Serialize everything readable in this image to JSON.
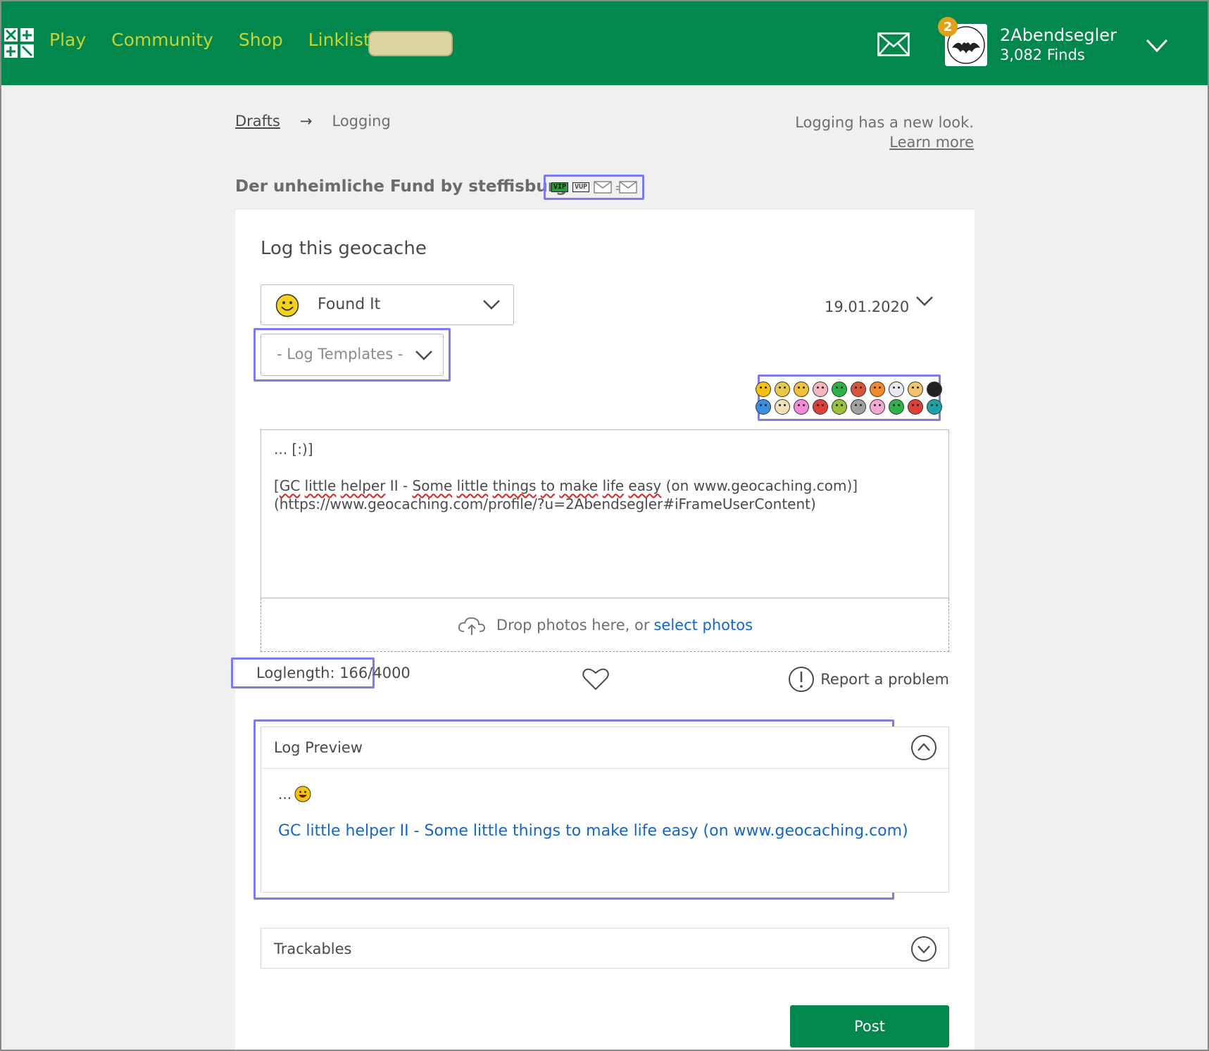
{
  "nav": {
    "items": [
      {
        "label": "Play"
      },
      {
        "label": "Community"
      },
      {
        "label": "Shop"
      },
      {
        "label": "Linklist"
      }
    ]
  },
  "user": {
    "name": "2Abendsegler",
    "finds": "3,082 Finds",
    "notifications": "2",
    "avatar_text": "2Abendsegler"
  },
  "breadcrumb": {
    "drafts": "Drafts",
    "arrow": "→",
    "current": "Logging"
  },
  "notice": {
    "text": "Logging has a new look.",
    "link": "Learn more"
  },
  "cache": {
    "title": "Der unheimliche Fund by steffisburg",
    "badges": [
      "VIP",
      "VUP"
    ]
  },
  "form": {
    "heading": "Log this geocache",
    "log_type": "Found It",
    "date": "19.01.2020",
    "templates_placeholder": "- Log Templates -",
    "log_text_line1": "... [:)]",
    "log_text_link_title_words": [
      "GC",
      "little",
      "helper",
      "II",
      "-",
      "Some",
      "little",
      "things",
      "to",
      "make",
      "life",
      "easy",
      "(on",
      "www.geocaching.com)]"
    ],
    "log_text_link_url": "(https://www.geocaching.com/profile/?u=2Abendsegler#iFrameUserContent)",
    "drop_text": "Drop photos here, or",
    "drop_link": "select photos",
    "loglength": "Loglength: 166/4000",
    "report": "Report a problem"
  },
  "preview": {
    "title": "Log Preview",
    "line1": "...",
    "link": "GC little helper II - Some little things to make life easy (on www.geocaching.com)"
  },
  "trackables": {
    "title": "Trackables"
  },
  "post": {
    "label": "Post"
  },
  "colors": {
    "header_green": "#02874d",
    "nav_yellow": "#c6d432",
    "link_blue": "#1266c9",
    "highlight": "#7b7bea"
  },
  "smilies": [
    "#f4c20d",
    "#e6c84a",
    "#f0c23a",
    "#f3b5c0",
    "#2fb24a",
    "#d8553a",
    "#f08a2a",
    "#e8e8f0",
    "#f2c46a",
    "#222222",
    "#3b8fe0",
    "#efe2b8",
    "#f48ad8",
    "#e0403a",
    "#9bbf3a",
    "#a0a0a0",
    "#f5a8d8",
    "#2fb24a",
    "#e0403a",
    "#1aa3a8"
  ]
}
